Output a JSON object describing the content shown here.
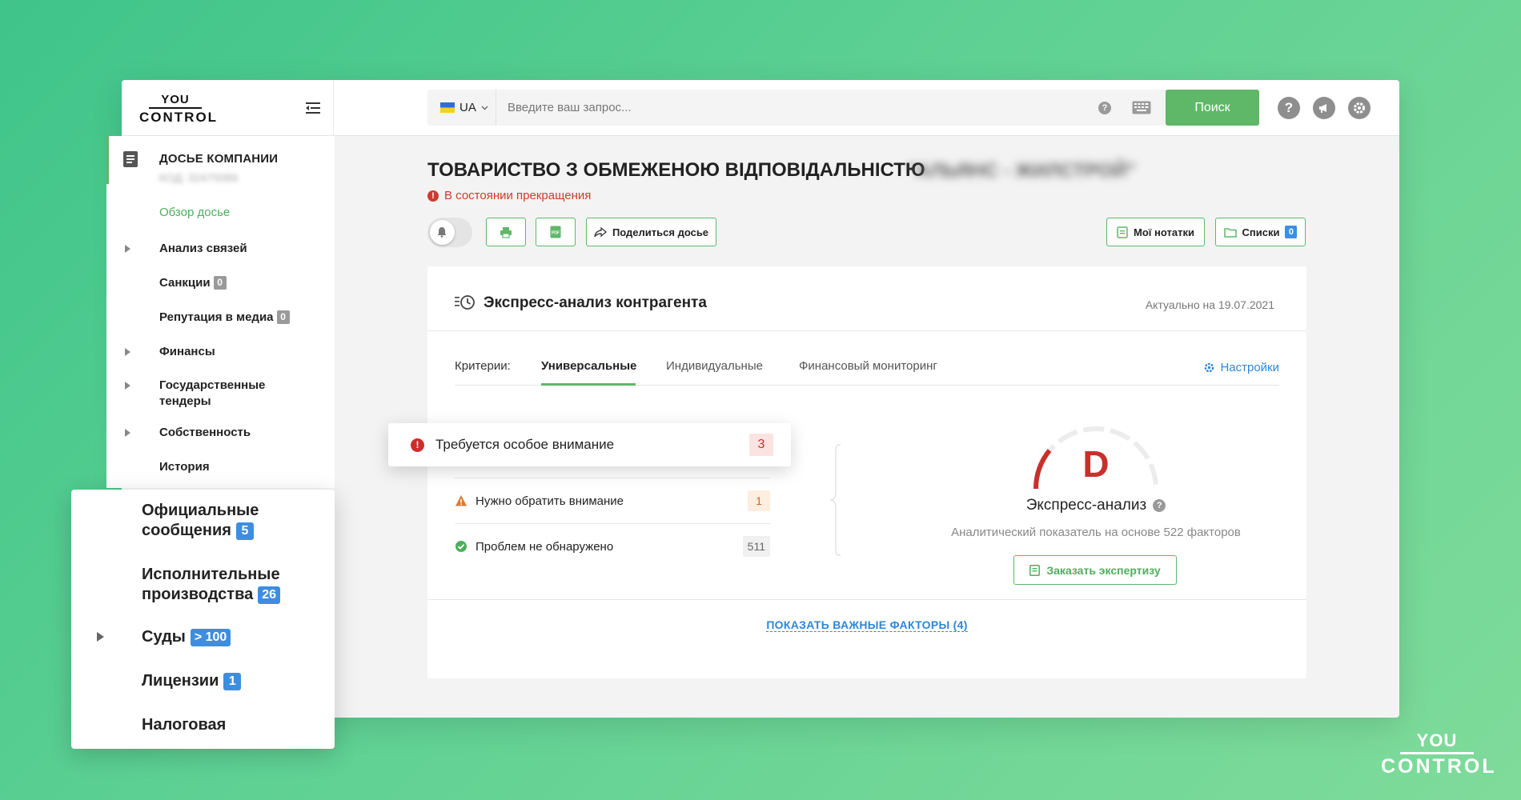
{
  "logo": {
    "line1": "YOU",
    "line2": "CONTROL"
  },
  "search": {
    "lang": "UA",
    "placeholder": "Введите ваш запрос...",
    "button": "Поиск"
  },
  "company": {
    "title_prefix": "ТОВАРИСТВО З ОБМЕЖЕНОЮ ВІДПОВІДАЛЬНІСТЮ",
    "name_blurred": "\"АЛЬЯНС - ЖИЛСТРОЙ\"",
    "status": "В состоянии прекращения"
  },
  "actions": {
    "share": "Поделиться досье",
    "notes": "Мої нотатки",
    "lists": "Списки",
    "lists_count": "0",
    "pdf_label": "PDF"
  },
  "sidebar": {
    "title": "ДОСЬЕ КОМПАНИИ",
    "code_blurred": "КОД: 32475089",
    "items": [
      {
        "label": "Обзор досье"
      },
      {
        "label": "Анализ связей"
      },
      {
        "label": "Санкции",
        "count": "0"
      },
      {
        "label": "Репутация в медиа",
        "count": "0"
      },
      {
        "label": "Финансы"
      },
      {
        "label": "Государственные тендеры"
      },
      {
        "label": "Собственность"
      },
      {
        "label": "История"
      }
    ]
  },
  "zoom_panel": {
    "items": [
      {
        "label_l1": "Официальные",
        "label_l2": "сообщения",
        "count": "5"
      },
      {
        "label_l1": "Исполнительные",
        "label_l2": "производства",
        "count": "26"
      },
      {
        "label": "Суды",
        "count": "> 100"
      },
      {
        "label": "Лицензии",
        "count": "1"
      },
      {
        "label": "Налоговая"
      }
    ]
  },
  "card": {
    "title": "Экспресс-анализ контрагента",
    "date": "Актуально на 19.07.2021",
    "tabs_label": "Критерии:",
    "tabs": [
      "Универсальные",
      "Индивидуальные",
      "Финансовый мониторинг"
    ],
    "settings": "Настройки",
    "rows": [
      {
        "label": "Требуется особое внимание",
        "count": "3"
      },
      {
        "label": "Нужно обратить внимание",
        "count": "1"
      },
      {
        "label": "Проблем не обнаружено",
        "count": "511"
      }
    ],
    "grade": "D",
    "gauge_title": "Экспресс-анализ",
    "gauge_sub": "Аналитический показатель на основе 522 факторов",
    "expertise_button": "Заказать экспертизу",
    "show_factors": "ПОКАЗАТЬ ВАЖНЫЕ ФАКТОРЫ (4)"
  },
  "colors": {
    "accent_green": "#5fb768",
    "danger_red": "#c9302c",
    "link_blue": "#2f86d6",
    "badge_blue": "#3d8ee0"
  },
  "icons": [
    "menu-icon",
    "flag-ua-icon",
    "help-icon",
    "keyboard-icon",
    "question-icon",
    "megaphone-icon",
    "gear-icon",
    "bell-icon",
    "print-icon",
    "pdf-icon",
    "share-icon",
    "notes-icon",
    "folder-icon",
    "history-icon",
    "settings-icon",
    "error-icon",
    "warning-icon",
    "check-icon"
  ]
}
